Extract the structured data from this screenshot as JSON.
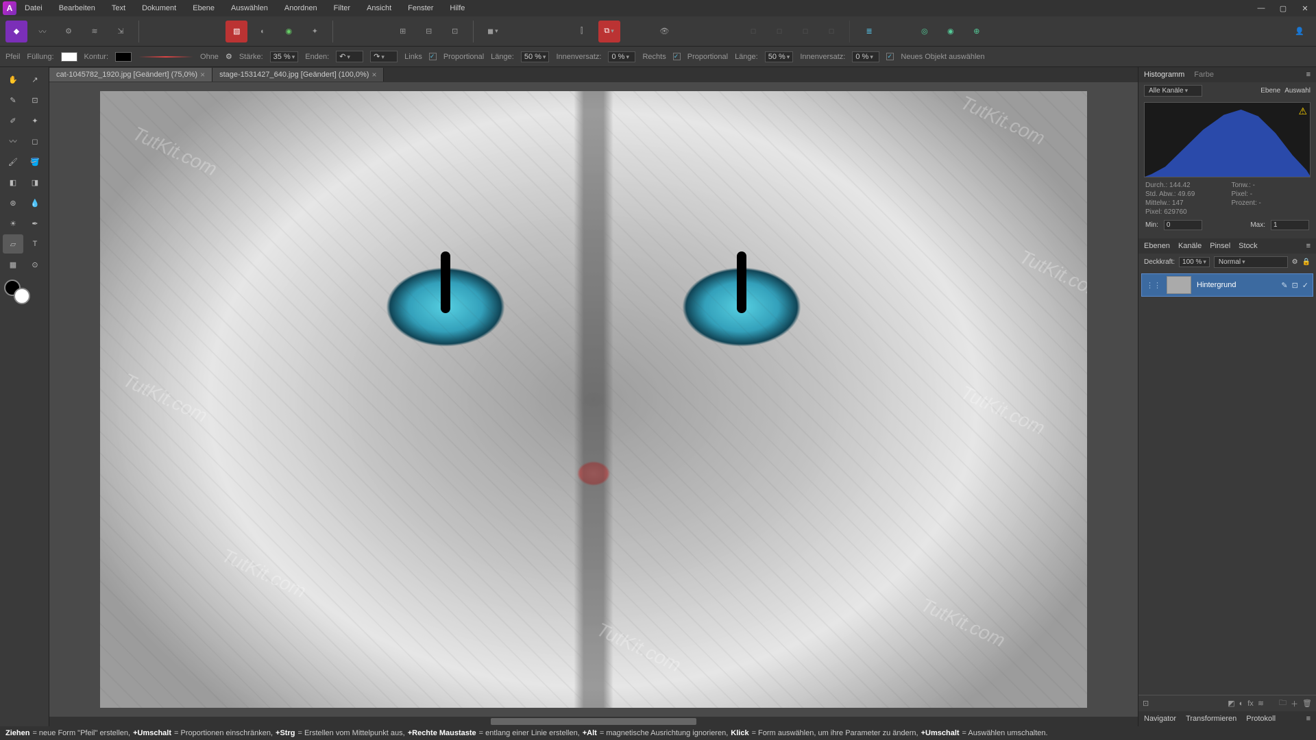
{
  "menu": [
    "Datei",
    "Bearbeiten",
    "Text",
    "Dokument",
    "Ebene",
    "Auswählen",
    "Anordnen",
    "Filter",
    "Ansicht",
    "Fenster",
    "Hilfe"
  ],
  "ctx": {
    "toolLabel": "Pfeil",
    "fillLabel": "Füllung:",
    "strokeLabel": "Kontur:",
    "endsNone": "Ohne",
    "strengthLabel": "Stärke:",
    "strength": "35 %",
    "endsLabel": "Enden:",
    "leftLabel": "Links",
    "proportional": "Proportional",
    "lengthLabel": "Länge:",
    "lengthL": "50 %",
    "insetLabel": "Innenversatz:",
    "insetL": "0 %",
    "rightLabel": "Rechts",
    "lengthR": "50 %",
    "insetR": "0 %",
    "newObj": "Neues Objekt auswählen"
  },
  "docs": [
    {
      "name": "cat-1045782_1920.jpg [Geändert] (75,0%)",
      "active": true
    },
    {
      "name": "stage-1531427_640.jpg [Geändert] (100,0%)",
      "active": false
    }
  ],
  "watermark": "TutKit.com",
  "histo": {
    "tabTitle": "Histogramm",
    "tabColor": "Farbe",
    "channel": "Alle Kanäle",
    "layer": "Ebene",
    "sel": "Auswahl",
    "stats": {
      "durch": "Durch.: 144.42",
      "tonw": "Tonw.: -",
      "stdabw": "Std. Abw.: 49.69",
      "pixel": "Pixel: -",
      "mittelw": "Mittelw.: 147",
      "prozent": "Prozent: -",
      "pixcnt": "Pixel: 629760"
    },
    "minLabel": "Min:",
    "min": "0",
    "maxLabel": "Max:",
    "max": "1"
  },
  "layers": {
    "tabs": [
      "Ebenen",
      "Kanäle",
      "Pinsel",
      "Stock"
    ],
    "opacityLabel": "Deckkraft:",
    "opacity": "100 %",
    "blend": "Normal",
    "rows": [
      {
        "name": "Hintergrund"
      }
    ]
  },
  "btabs": [
    "Navigator",
    "Transformieren",
    "Protokoll"
  ],
  "status": {
    "p1": "Ziehen",
    "t1": " = neue Form \"Pfeil\" erstellen, ",
    "p2": "+Umschalt",
    "t2": " = Proportionen einschränken, ",
    "p3": "+Strg",
    "t3": " = Erstellen vom Mittelpunkt aus, ",
    "p4": "+Rechte Maustaste",
    "t4": " = entlang einer Linie erstellen, ",
    "p5": "+Alt",
    "t5": " = magnetische Ausrichtung ignorieren, ",
    "p6": "Klick",
    "t6": " = Form auswählen, um ihre Parameter zu ändern, ",
    "p7": "+Umschalt",
    "t7": " = Auswählen umschalten."
  }
}
